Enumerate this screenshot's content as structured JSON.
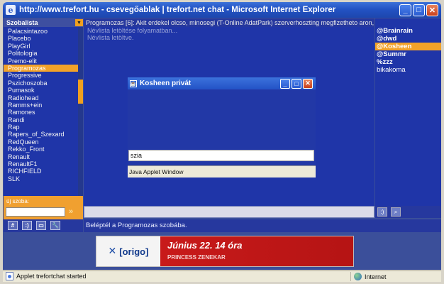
{
  "window": {
    "title": "http://www.trefort.hu - csevegőablak | trefort.net chat - Microsoft Internet Explorer",
    "icon": "ie-icon",
    "min": "_",
    "max": "□",
    "close": "✕"
  },
  "sidebar": {
    "title": "Szobalista",
    "rooms": [
      "Palacsintazoo",
      "Placebo",
      "PlayGirl",
      "Politologia",
      "Premo-elit",
      "Programozas",
      "Progressive",
      "Pszichoszoba",
      "Pumasok",
      "Radiohead",
      "Ramms+ein",
      "Ramones",
      "Randi",
      "Rap",
      "Rapers_of_Szexard",
      "RedQueen",
      "Rekko_Front",
      "Renault",
      "RenaultF1",
      "RICHFIELD",
      "SLK"
    ],
    "selected_index": 5,
    "new_room_label": "új szoba:",
    "new_room_value": "",
    "new_room_go": "»"
  },
  "main": {
    "topic": "Programozas [6]: Akit erdekel olcso, minosegi (T-Online AdatPark) szerverhoszting megfizetheto aron, http://axele",
    "log": [
      "Névlista letöltése folyamatban...",
      "Névlista letöltve."
    ],
    "input_value": ""
  },
  "users": {
    "list": [
      "@Brainrain",
      "@dwd",
      "@Kosheen",
      "@Summr",
      "%zzz",
      "bikakoma"
    ],
    "selected_index": 2
  },
  "toolbar": {
    "hash": "#",
    "smile": ":)",
    "box": "▭",
    "tool": "🔧"
  },
  "status_message": "Beléptél a Programozas szobába.",
  "banner": {
    "brand": "[origo]",
    "date": "Június 22. 14 óra",
    "subtitle": "PRINCESS ZENEKAR",
    "accent": "#c81a1a"
  },
  "applet": {
    "title": "Kosheen privát",
    "input_value": "szia",
    "footer": "Java Applet Window"
  },
  "statusbar": {
    "left": "Applet trefortchat started",
    "zone": "Internet"
  }
}
